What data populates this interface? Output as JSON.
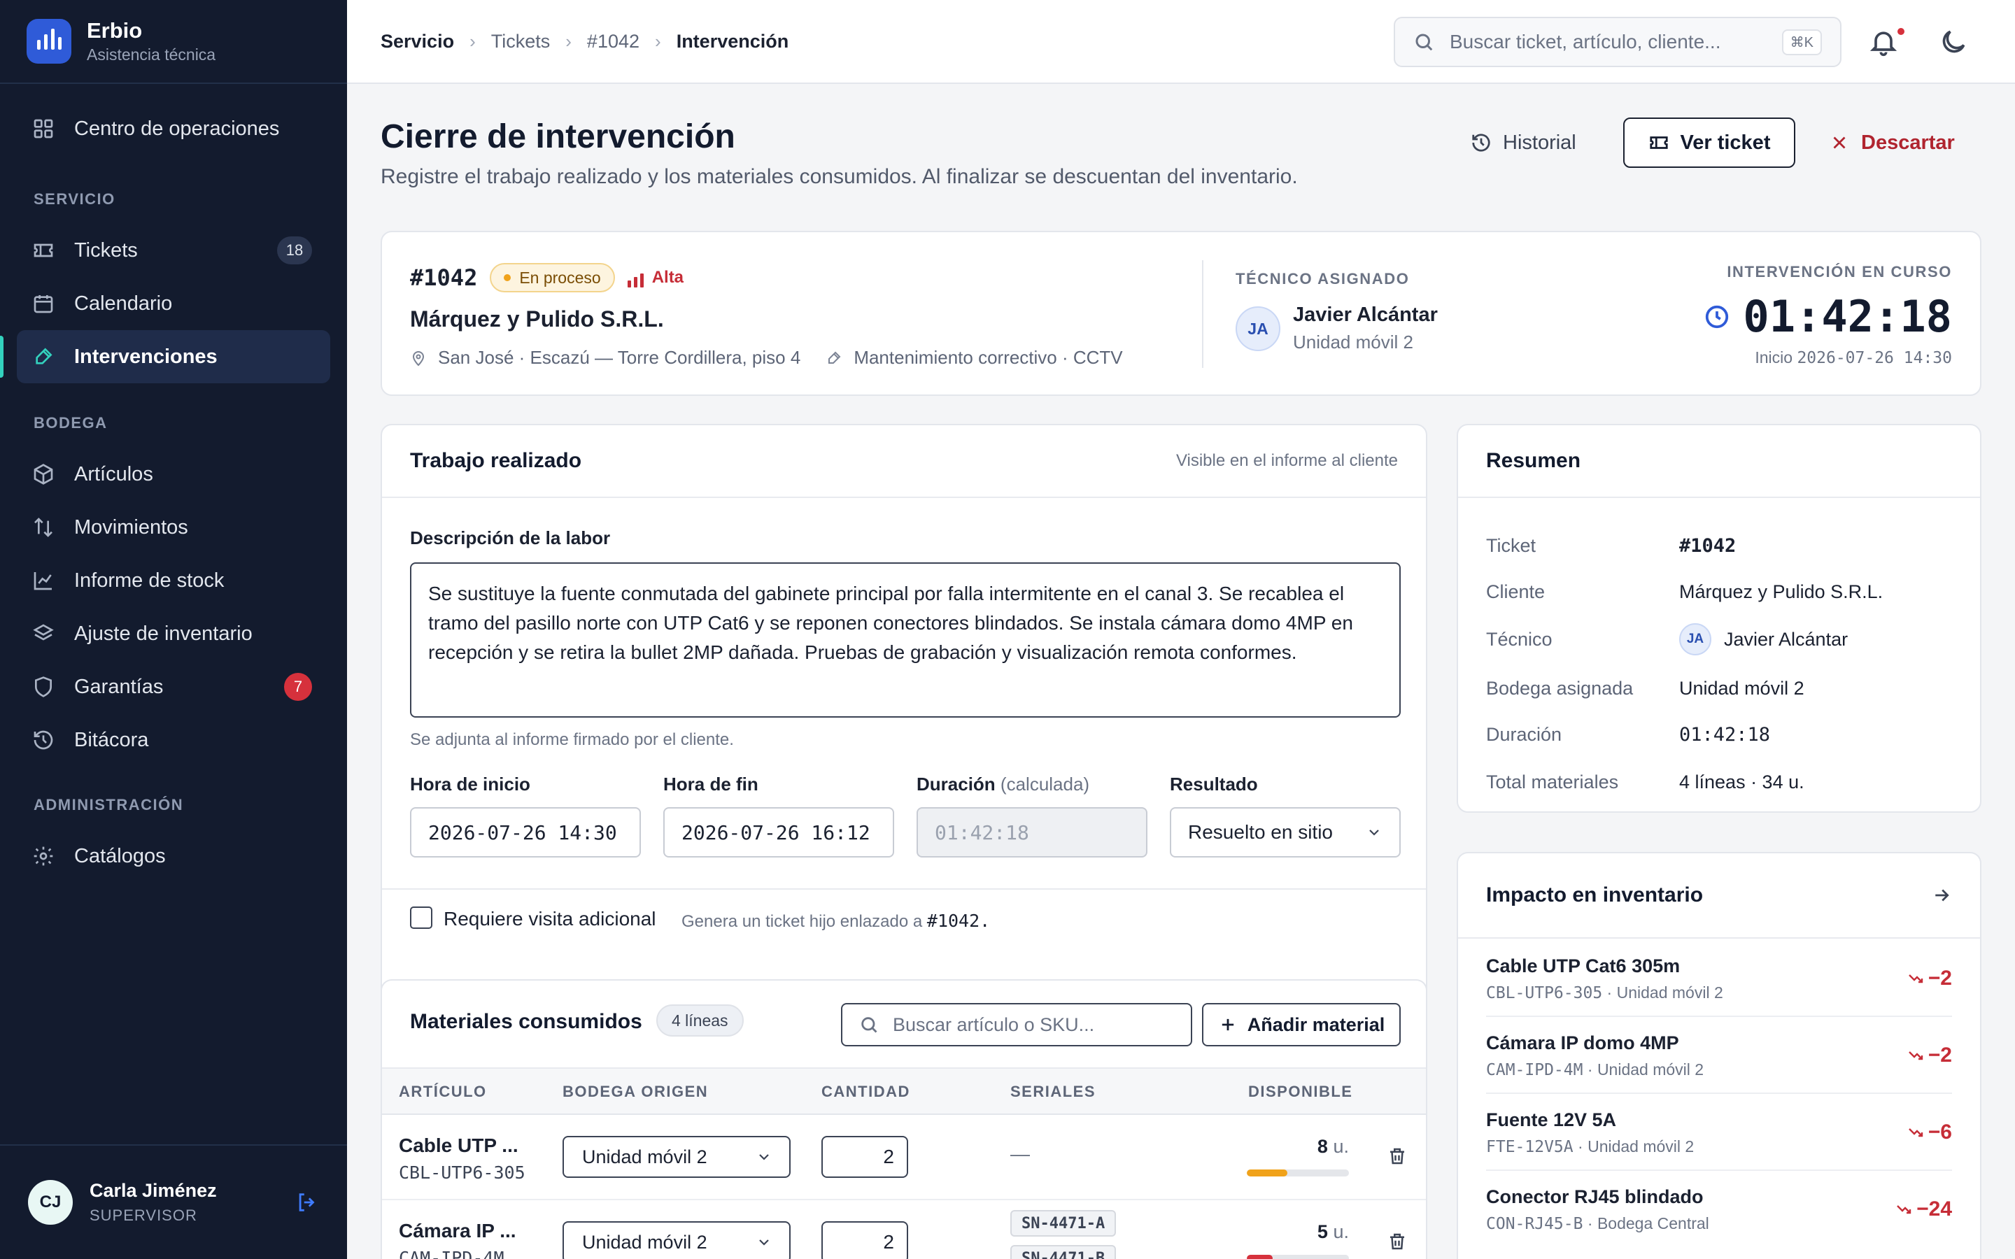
{
  "app": {
    "name": "Erbio",
    "subtitle": "Asistencia técnica"
  },
  "sidebar": {
    "top_item": {
      "label": "Centro de operaciones",
      "icon": "grid-icon"
    },
    "sections": [
      {
        "title": "SERVICIO",
        "items": [
          {
            "label": "Tickets",
            "icon": "ticket-icon",
            "badge": "18"
          },
          {
            "label": "Calendario",
            "icon": "calendar-icon"
          },
          {
            "label": "Intervenciones",
            "icon": "wrench-icon",
            "active": true
          }
        ]
      },
      {
        "title": "BODEGA",
        "items": [
          {
            "label": "Artículos",
            "icon": "box-icon"
          },
          {
            "label": "Movimientos",
            "icon": "arrows-icon"
          },
          {
            "label": "Informe de stock",
            "icon": "chart-icon"
          },
          {
            "label": "Ajuste de inventario",
            "icon": "layers-icon"
          },
          {
            "label": "Garantías",
            "icon": "shield-icon",
            "badge": "7"
          },
          {
            "label": "Bitácora",
            "icon": "history-icon"
          }
        ]
      },
      {
        "title": "ADMINISTRACIÓN",
        "items": [
          {
            "label": "Catálogos",
            "icon": "gear-icon"
          }
        ]
      }
    ],
    "user": {
      "initials": "CJ",
      "name": "Carla Jiménez",
      "role": "SUPERVISOR"
    }
  },
  "topbar": {
    "breadcrumb": [
      "Servicio",
      "Tickets",
      "#1042",
      "Intervención"
    ],
    "search_placeholder": "Buscar ticket, artículo, cliente...",
    "search_shortcut": "⌘K"
  },
  "page": {
    "title": "Cierre de intervención",
    "subtitle": "Registre el trabajo realizado y los materiales consumidos. Al finalizar se descuentan del inventario.",
    "actions": {
      "history": "Historial",
      "view_ticket": "Ver ticket",
      "discard": "Descartar"
    }
  },
  "ticket": {
    "id": "#1042",
    "status": "En proceso",
    "priority": "Alta",
    "client": "Márquez y Pulido S.R.L.",
    "location": "San José · Escazú — Torre Cordillera, piso 4",
    "service": "Mantenimiento correctivo · CCTV",
    "tech_label": "TÉCNICO ASIGNADO",
    "tech_initials": "JA",
    "tech_name": "Javier Alcántar",
    "tech_unit": "Unidad móvil 2",
    "timer_label": "INTERVENCIÓN EN CURSO",
    "timer": "01:42:18",
    "start_prefix": "Inicio",
    "start_value": "2026-07-26 14:30"
  },
  "work": {
    "title": "Trabajo realizado",
    "note": "Visible en el informe al cliente",
    "desc_label": "Descripción de la labor",
    "description": "Se sustituye la fuente conmutada del gabinete principal por falla intermitente en el canal 3. Se recablea el tramo del pasillo norte con UTP Cat6 y se reponen conectores blindados. Se instala cámara domo 4MP en recepción y se retira la bullet 2MP dañada. Pruebas de grabación y visualización remota conformes.",
    "help": "Se adjunta al informe firmado por el cliente.",
    "start_label": "Hora de inicio",
    "start_value": "2026-07-26 14:30",
    "end_label": "Hora de fin",
    "end_value": "2026-07-26 16:12",
    "duration_label": "Duración",
    "duration_hint": "(calculada)",
    "duration_value": "01:42:18",
    "result_label": "Resultado",
    "result_value": "Resuelto en sitio",
    "revisit_label": "Requiere visita adicional",
    "revisit_hint": "Genera un ticket hijo enlazado a",
    "revisit_ref": "#1042.",
    "revisit_checked": false
  },
  "materials": {
    "title": "Materiales consumidos",
    "count": "4 líneas",
    "search_placeholder": "Buscar artículo o SKU...",
    "add_label": "Añadir material",
    "columns": [
      "ARTÍCULO",
      "BODEGA ORIGEN",
      "CANTIDAD",
      "SERIALES",
      "DISPONIBLE"
    ],
    "rows": [
      {
        "name": "Cable UTP ...",
        "sku": "CBL-UTP6-305",
        "warehouse": "Unidad móvil 2",
        "qty": "2",
        "serials": [
          "—"
        ],
        "available": "8",
        "unit": "u.",
        "level": 0.4,
        "level_color": "#f0a21a"
      },
      {
        "name": "Cámara IP ...",
        "sku": "CAM-IPD-4M",
        "warehouse": "Unidad móvil 2",
        "qty": "2",
        "serials": [
          "SN-4471-A",
          "SN-4471-B"
        ],
        "available": "5",
        "unit": "u.",
        "level": 0.25,
        "level_color": "#d6313c"
      }
    ]
  },
  "summary": {
    "title": "Resumen",
    "rows": [
      {
        "k": "Ticket",
        "v": "#1042"
      },
      {
        "k": "Cliente",
        "v": "Márquez y Pulido S.R.L."
      },
      {
        "k": "Técnico",
        "v": "Javier Alcántar",
        "initials": "JA"
      },
      {
        "k": "Bodega asignada",
        "v": "Unidad móvil 2"
      },
      {
        "k": "Duración",
        "v": "01:42:18"
      },
      {
        "k": "Total materiales",
        "v": "4 líneas · 34 u."
      }
    ]
  },
  "impact": {
    "title": "Impacto en inventario",
    "items": [
      {
        "name": "Cable UTP Cat6 305m",
        "sku": "CBL-UTP6-305",
        "where": "Unidad móvil 2",
        "delta": "−2"
      },
      {
        "name": "Cámara IP domo 4MP",
        "sku": "CAM-IPD-4M",
        "where": "Unidad móvil 2",
        "delta": "−2"
      },
      {
        "name": "Fuente 12V 5A",
        "sku": "FTE-12V5A",
        "where": "Unidad móvil 2",
        "delta": "−6"
      },
      {
        "name": "Conector RJ45 blindado",
        "sku": "CON-RJ45-B",
        "where": "Bodega Central",
        "delta": "−24"
      }
    ]
  },
  "colors": {
    "accent": "#2f5bd8",
    "active": "#33d2be",
    "danger": "#c62d37",
    "sidebar": "#131b2e"
  }
}
